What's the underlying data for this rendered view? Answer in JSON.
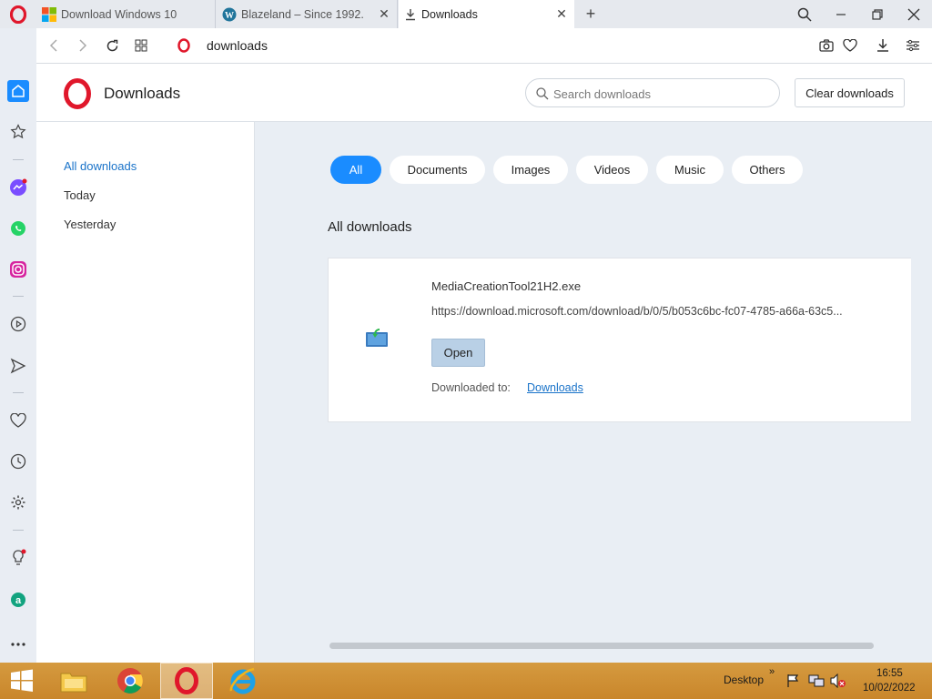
{
  "tabs": [
    {
      "title": "Download Windows 10",
      "icon": "windows-logo-icon"
    },
    {
      "title": "Blazeland – Since 1992.",
      "icon": "wordpress-icon"
    },
    {
      "title": "Downloads",
      "icon": "download-icon",
      "active": true
    }
  ],
  "addressbar": {
    "url": "downloads"
  },
  "header": {
    "title": "Downloads",
    "search_placeholder": "Search downloads",
    "clear_label": "Clear downloads"
  },
  "leftnav": {
    "items": [
      {
        "label": "All downloads",
        "active": true
      },
      {
        "label": "Today"
      },
      {
        "label": "Yesterday"
      }
    ]
  },
  "filters": {
    "items": [
      {
        "label": "All",
        "active": true
      },
      {
        "label": "Documents"
      },
      {
        "label": "Images"
      },
      {
        "label": "Videos"
      },
      {
        "label": "Music"
      },
      {
        "label": "Others"
      }
    ]
  },
  "section": {
    "heading": "All downloads"
  },
  "download": {
    "file_name": "MediaCreationTool21H2.exe",
    "url": "https://download.microsoft.com/download/b/0/5/b053c6bc-fc07-4785-a66a-63c5...",
    "open_label": "Open",
    "downloaded_to_label": "Downloaded to:",
    "folder": "Downloads"
  },
  "taskbar": {
    "desktop_label": "Desktop",
    "chevron": "»",
    "time": "16:55",
    "date": "10/02/2022"
  },
  "colors": {
    "accent": "#1a8cff",
    "opera_red": "#e0172b",
    "taskbar": "#cf8f35"
  }
}
